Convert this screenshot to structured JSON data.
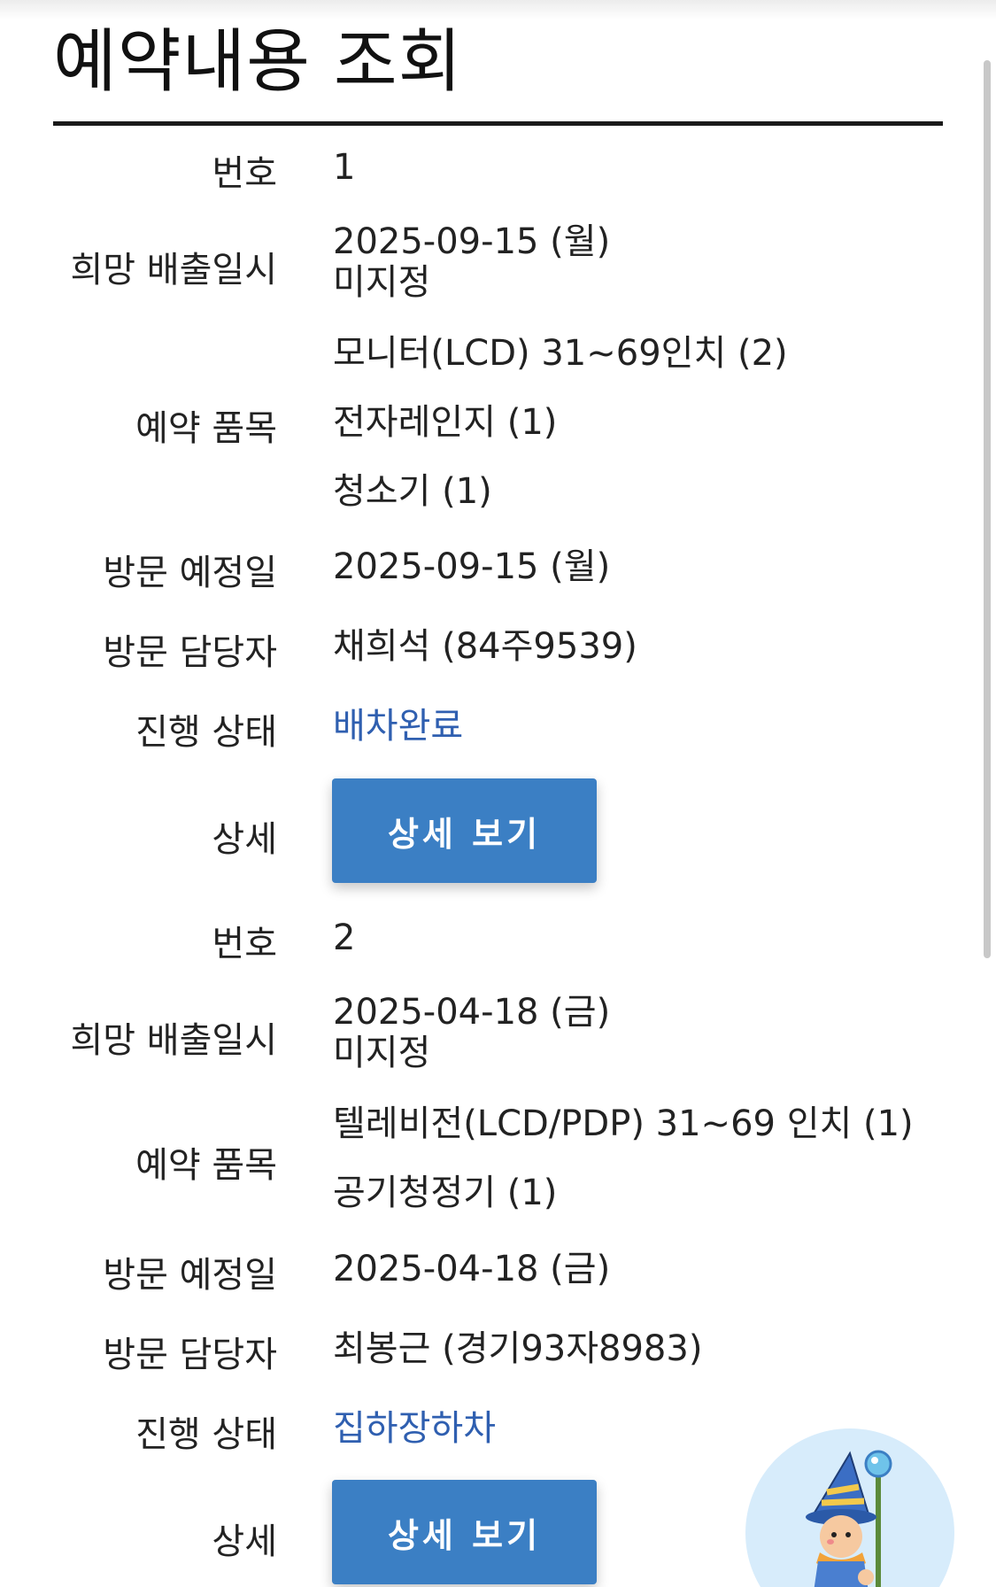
{
  "page_title": "예약내용 조회",
  "labels": {
    "number": "번호",
    "desired_datetime": "희망 배출일시",
    "items": "예약 품목",
    "visit_date": "방문 예정일",
    "visit_staff": "방문 담당자",
    "progress_status": "진행 상태",
    "detail": "상세"
  },
  "detail_button_label": "상세 보기",
  "status_color": "#2f5fb0",
  "button_color": "#3b7fc4",
  "reservations": [
    {
      "number": "1",
      "desired_date": "2025-09-15 (월)",
      "desired_time": "미지정",
      "items": [
        "모니터(LCD) 31~69인치 (2)",
        "전자레인지 (1)",
        "청소기 (1)"
      ],
      "visit_date": "2025-09-15 (월)",
      "visit_staff": "채희석 (84주9539)",
      "status": "배차완료"
    },
    {
      "number": "2",
      "desired_date": "2025-04-18 (금)",
      "desired_time": "미지정",
      "items": [
        "텔레비전(LCD/PDP) 31~69 인치 (1)",
        "공기청정기 (1)"
      ],
      "visit_date": "2025-04-18 (금)",
      "visit_staff": "최봉근 (경기93자8983)",
      "status": "집하장하차"
    }
  ],
  "floating_button": {
    "icon": "wizard-mascot-icon"
  }
}
